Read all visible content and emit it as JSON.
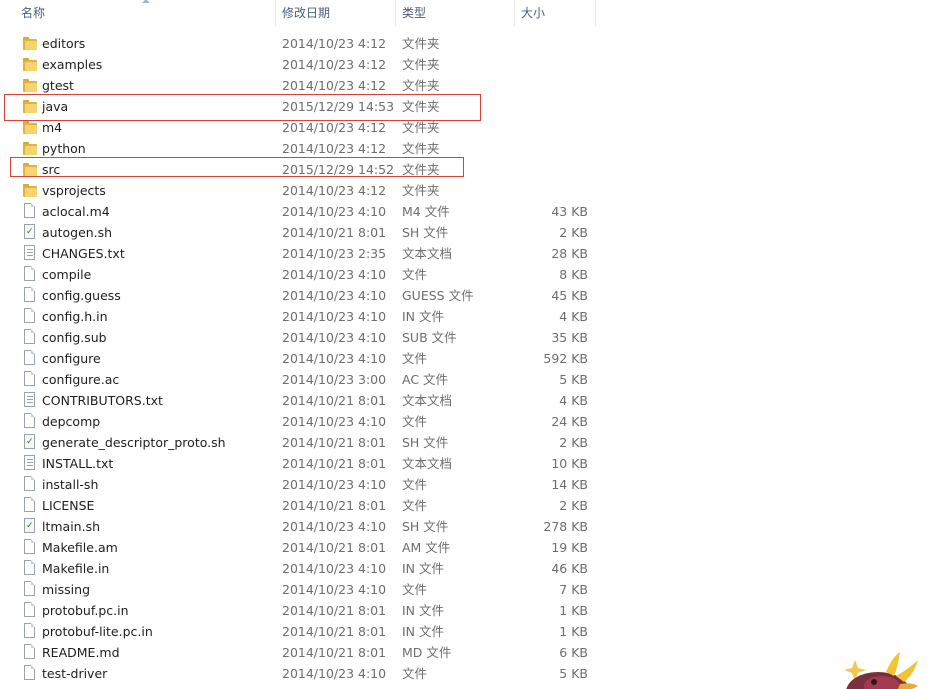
{
  "columns": {
    "name": "名称",
    "date": "修改日期",
    "type": "类型",
    "size": "大小"
  },
  "files": [
    {
      "name": "editors",
      "date": "2014/10/23 4:12",
      "type": "文件夹",
      "size": "",
      "icon": "folder-icon"
    },
    {
      "name": "examples",
      "date": "2014/10/23 4:12",
      "type": "文件夹",
      "size": "",
      "icon": "folder-icon"
    },
    {
      "name": "gtest",
      "date": "2014/10/23 4:12",
      "type": "文件夹",
      "size": "",
      "icon": "folder-icon"
    },
    {
      "name": "java",
      "date": "2015/12/29 14:53",
      "type": "文件夹",
      "size": "",
      "icon": "folder-icon",
      "highlighted": true
    },
    {
      "name": "m4",
      "date": "2014/10/23 4:12",
      "type": "文件夹",
      "size": "",
      "icon": "folder-icon"
    },
    {
      "name": "python",
      "date": "2014/10/23 4:12",
      "type": "文件夹",
      "size": "",
      "icon": "folder-icon"
    },
    {
      "name": "src",
      "date": "2015/12/29 14:52",
      "type": "文件夹",
      "size": "",
      "icon": "folder-icon",
      "highlighted": true
    },
    {
      "name": "vsprojects",
      "date": "2014/10/23 4:12",
      "type": "文件夹",
      "size": "",
      "icon": "folder-icon"
    },
    {
      "name": "aclocal.m4",
      "date": "2014/10/23 4:10",
      "type": "M4 文件",
      "size": "43 KB",
      "icon": "file-icon"
    },
    {
      "name": "autogen.sh",
      "date": "2014/10/21 8:01",
      "type": "SH 文件",
      "size": "2 KB",
      "icon": "script-icon"
    },
    {
      "name": "CHANGES.txt",
      "date": "2014/10/23 2:35",
      "type": "文本文档",
      "size": "28 KB",
      "icon": "text-file-icon"
    },
    {
      "name": "compile",
      "date": "2014/10/23 4:10",
      "type": "文件",
      "size": "8 KB",
      "icon": "file-icon"
    },
    {
      "name": "config.guess",
      "date": "2014/10/23 4:10",
      "type": "GUESS 文件",
      "size": "45 KB",
      "icon": "file-icon"
    },
    {
      "name": "config.h.in",
      "date": "2014/10/23 4:10",
      "type": "IN 文件",
      "size": "4 KB",
      "icon": "file-icon"
    },
    {
      "name": "config.sub",
      "date": "2014/10/23 4:10",
      "type": "SUB 文件",
      "size": "35 KB",
      "icon": "file-icon"
    },
    {
      "name": "configure",
      "date": "2014/10/23 4:10",
      "type": "文件",
      "size": "592 KB",
      "icon": "file-icon"
    },
    {
      "name": "configure.ac",
      "date": "2014/10/23 3:00",
      "type": "AC 文件",
      "size": "5 KB",
      "icon": "file-icon"
    },
    {
      "name": "CONTRIBUTORS.txt",
      "date": "2014/10/21 8:01",
      "type": "文本文档",
      "size": "4 KB",
      "icon": "text-file-icon"
    },
    {
      "name": "depcomp",
      "date": "2014/10/23 4:10",
      "type": "文件",
      "size": "24 KB",
      "icon": "file-icon"
    },
    {
      "name": "generate_descriptor_proto.sh",
      "date": "2014/10/21 8:01",
      "type": "SH 文件",
      "size": "2 KB",
      "icon": "script-icon"
    },
    {
      "name": "INSTALL.txt",
      "date": "2014/10/21 8:01",
      "type": "文本文档",
      "size": "10 KB",
      "icon": "text-file-icon"
    },
    {
      "name": "install-sh",
      "date": "2014/10/23 4:10",
      "type": "文件",
      "size": "14 KB",
      "icon": "file-icon"
    },
    {
      "name": "LICENSE",
      "date": "2014/10/21 8:01",
      "type": "文件",
      "size": "2 KB",
      "icon": "file-icon"
    },
    {
      "name": "ltmain.sh",
      "date": "2014/10/23 4:10",
      "type": "SH 文件",
      "size": "278 KB",
      "icon": "script-icon"
    },
    {
      "name": "Makefile.am",
      "date": "2014/10/21 8:01",
      "type": "AM 文件",
      "size": "19 KB",
      "icon": "file-icon"
    },
    {
      "name": "Makefile.in",
      "date": "2014/10/23 4:10",
      "type": "IN 文件",
      "size": "46 KB",
      "icon": "file-icon"
    },
    {
      "name": "missing",
      "date": "2014/10/23 4:10",
      "type": "文件",
      "size": "7 KB",
      "icon": "file-icon"
    },
    {
      "name": "protobuf.pc.in",
      "date": "2014/10/21 8:01",
      "type": "IN 文件",
      "size": "1 KB",
      "icon": "file-icon"
    },
    {
      "name": "protobuf-lite.pc.in",
      "date": "2014/10/21 8:01",
      "type": "IN 文件",
      "size": "1 KB",
      "icon": "file-icon"
    },
    {
      "name": "README.md",
      "date": "2014/10/21 8:01",
      "type": "MD 文件",
      "size": "6 KB",
      "icon": "file-icon"
    },
    {
      "name": "test-driver",
      "date": "2014/10/23 4:10",
      "type": "文件",
      "size": "5 KB",
      "icon": "file-icon"
    }
  ],
  "colors": {
    "highlight": "#d9413b",
    "folder": "#e2b33c",
    "header_text": "#4c607a"
  }
}
